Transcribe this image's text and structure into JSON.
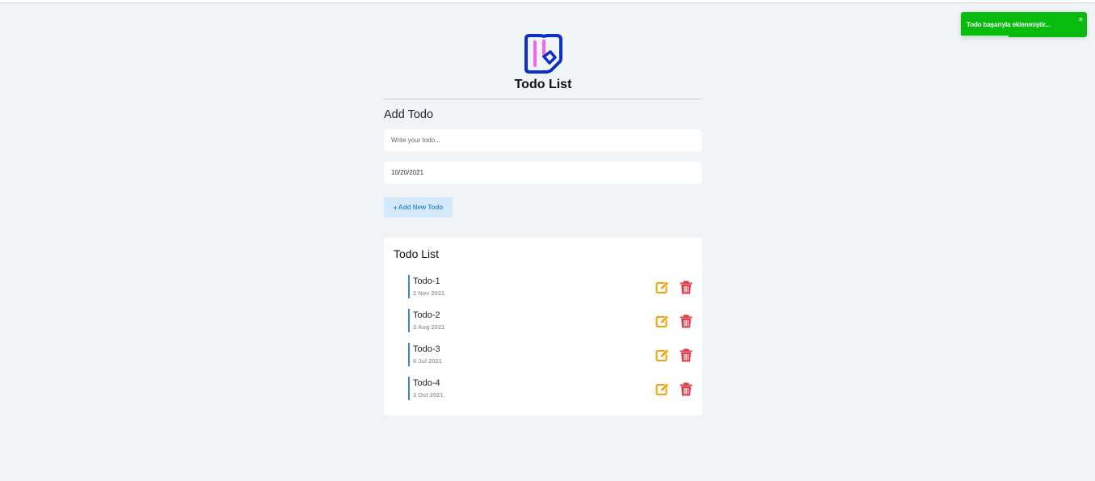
{
  "app": {
    "title": "Todo List",
    "logo_icon": "notebook-pen-icon"
  },
  "toast": {
    "message": "Todo başarıyla eklenmiştir...",
    "close_label": "×",
    "color": "#07bc0c",
    "progress_fraction": 0.38
  },
  "form": {
    "heading": "Add Todo",
    "todo_placeholder": "Write your todo...",
    "todo_value": "",
    "date_value": "10/20/2021",
    "add_button_icon": "+",
    "add_button_label": "Add New Todo"
  },
  "list": {
    "heading": "Todo List",
    "items": [
      {
        "name": "Todo-1",
        "date": "2 Nov 2021"
      },
      {
        "name": "Todo-2",
        "date": "2 Aug 2021"
      },
      {
        "name": "Todo-3",
        "date": "6 Jul 2021"
      },
      {
        "name": "Todo-4",
        "date": "3 Oct 2021"
      }
    ],
    "edit_icon": "edit-icon",
    "delete_icon": "trash-icon",
    "colors": {
      "accent_bar": "#3a87d6",
      "edit": "#f2a20c",
      "delete": "#e8394a"
    }
  }
}
